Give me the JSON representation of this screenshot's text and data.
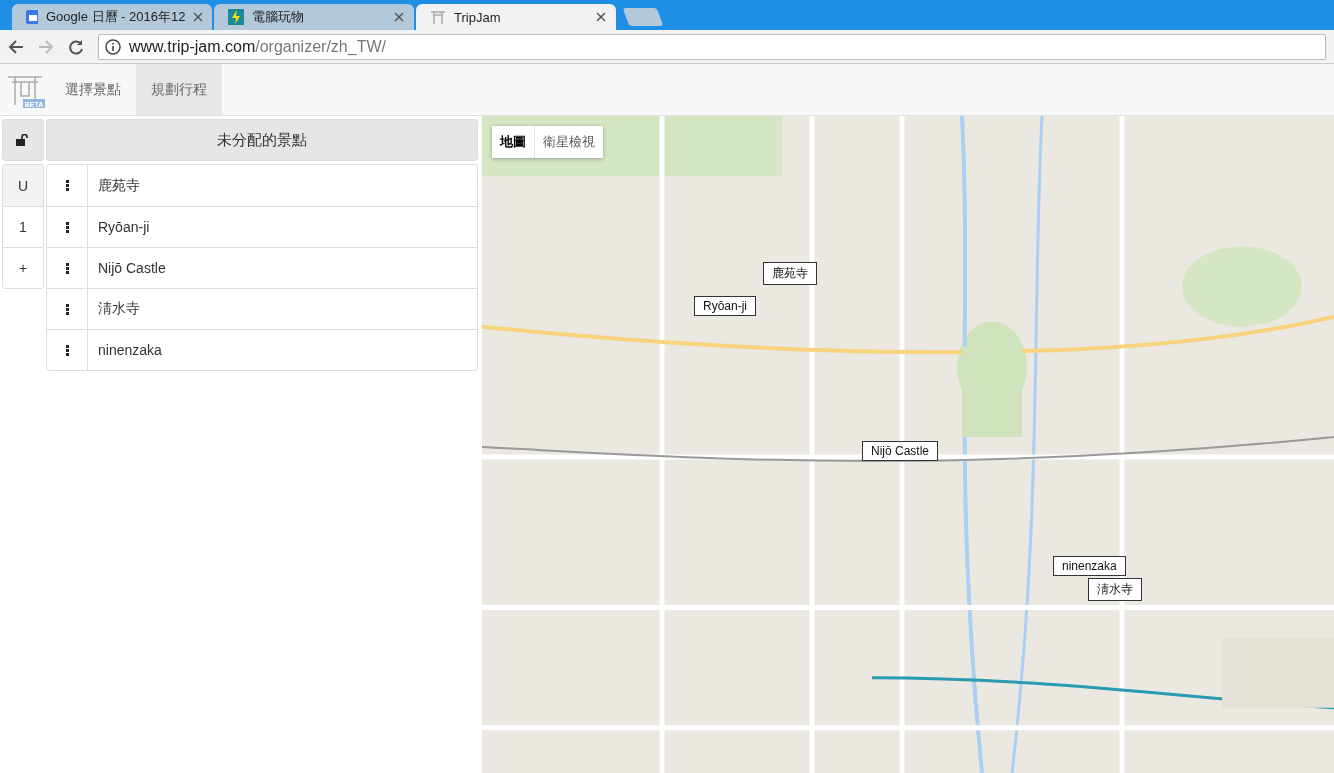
{
  "browser": {
    "tabs": [
      {
        "title": "Google 日曆 - 2016年12",
        "selected": false
      },
      {
        "title": "電腦玩物",
        "selected": false
      },
      {
        "title": "TripJam",
        "selected": true
      }
    ],
    "address": {
      "host": "www.trip-jam.com",
      "path": "/organizer/zh_TW/"
    }
  },
  "nav": {
    "logo_badge": "BETA",
    "tabs": [
      {
        "label": "選擇景點",
        "selected": false
      },
      {
        "label": "規劃行程",
        "selected": true
      }
    ]
  },
  "planner": {
    "lock": {
      "locked": false
    },
    "title": "未分配的景點",
    "days": [
      {
        "label": "U",
        "selected": true
      },
      {
        "label": "1",
        "selected": false
      },
      {
        "label": "+",
        "selected": false
      }
    ],
    "places": [
      {
        "name": "鹿苑寺"
      },
      {
        "name": "Ryōan-ji"
      },
      {
        "name": "Nijō Castle"
      },
      {
        "name": "淸水寺"
      },
      {
        "name": "ninenzaka"
      }
    ]
  },
  "map": {
    "kind": "picture",
    "type_control": [
      {
        "label": "地圖",
        "selected": true
      },
      {
        "label": "衛星檢視",
        "selected": false
      }
    ],
    "markers": [
      "鹿苑寺",
      "Ryōan-ji",
      "Nijō Castle",
      "ninenzaka",
      "淸水寺"
    ]
  }
}
